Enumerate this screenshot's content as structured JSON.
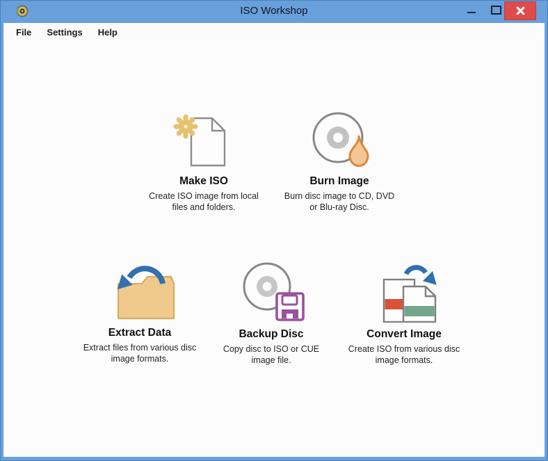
{
  "window": {
    "title": "ISO Workshop",
    "controls": [
      {
        "name": "minimize"
      },
      {
        "name": "maximize"
      },
      {
        "name": "close"
      }
    ]
  },
  "menubar": {
    "items": [
      {
        "label": "File"
      },
      {
        "label": "Settings"
      },
      {
        "label": "Help"
      }
    ]
  },
  "actions": [
    {
      "id": "make-iso",
      "title": "Make ISO",
      "description_line1": "Create ISO image from local",
      "description_line2": "files and folders.",
      "icon": "make-iso-document-gear-icon"
    },
    {
      "id": "burn-image",
      "title": "Burn Image",
      "description_line1": "Burn disc image to CD, DVD",
      "description_line2": "or Blu-ray Disc.",
      "icon": "burn-disc-flame-icon"
    },
    {
      "id": "extract-data",
      "title": "Extract Data",
      "description_line1": "Extract files from various disc",
      "description_line2": "image formats.",
      "icon": "extract-folder-arrow-icon"
    },
    {
      "id": "backup-disc",
      "title": "Backup Disc",
      "description_line1": "Copy disc to ISO or CUE",
      "description_line2": "image file.",
      "icon": "backup-disc-floppy-icon"
    },
    {
      "id": "convert-image",
      "title": "Convert Image",
      "description_line1": "Create ISO from various disc",
      "description_line2": "image formats.",
      "icon": "convert-documents-arrow-icon"
    }
  ],
  "colors": {
    "titlebar_blue": "#67A0DB",
    "window_border_blue": "#5E9AD6",
    "close_button_red": "#DE4B4B",
    "accent_arrow_blue": "#346FB0",
    "folder_tan": "#EFCA8C",
    "flame_orange": "#E0873B",
    "floppy_purple": "#99519E",
    "gear_gold": "#E6C26E",
    "stripe_red": "#D95437",
    "stripe_green": "#73A68B"
  }
}
